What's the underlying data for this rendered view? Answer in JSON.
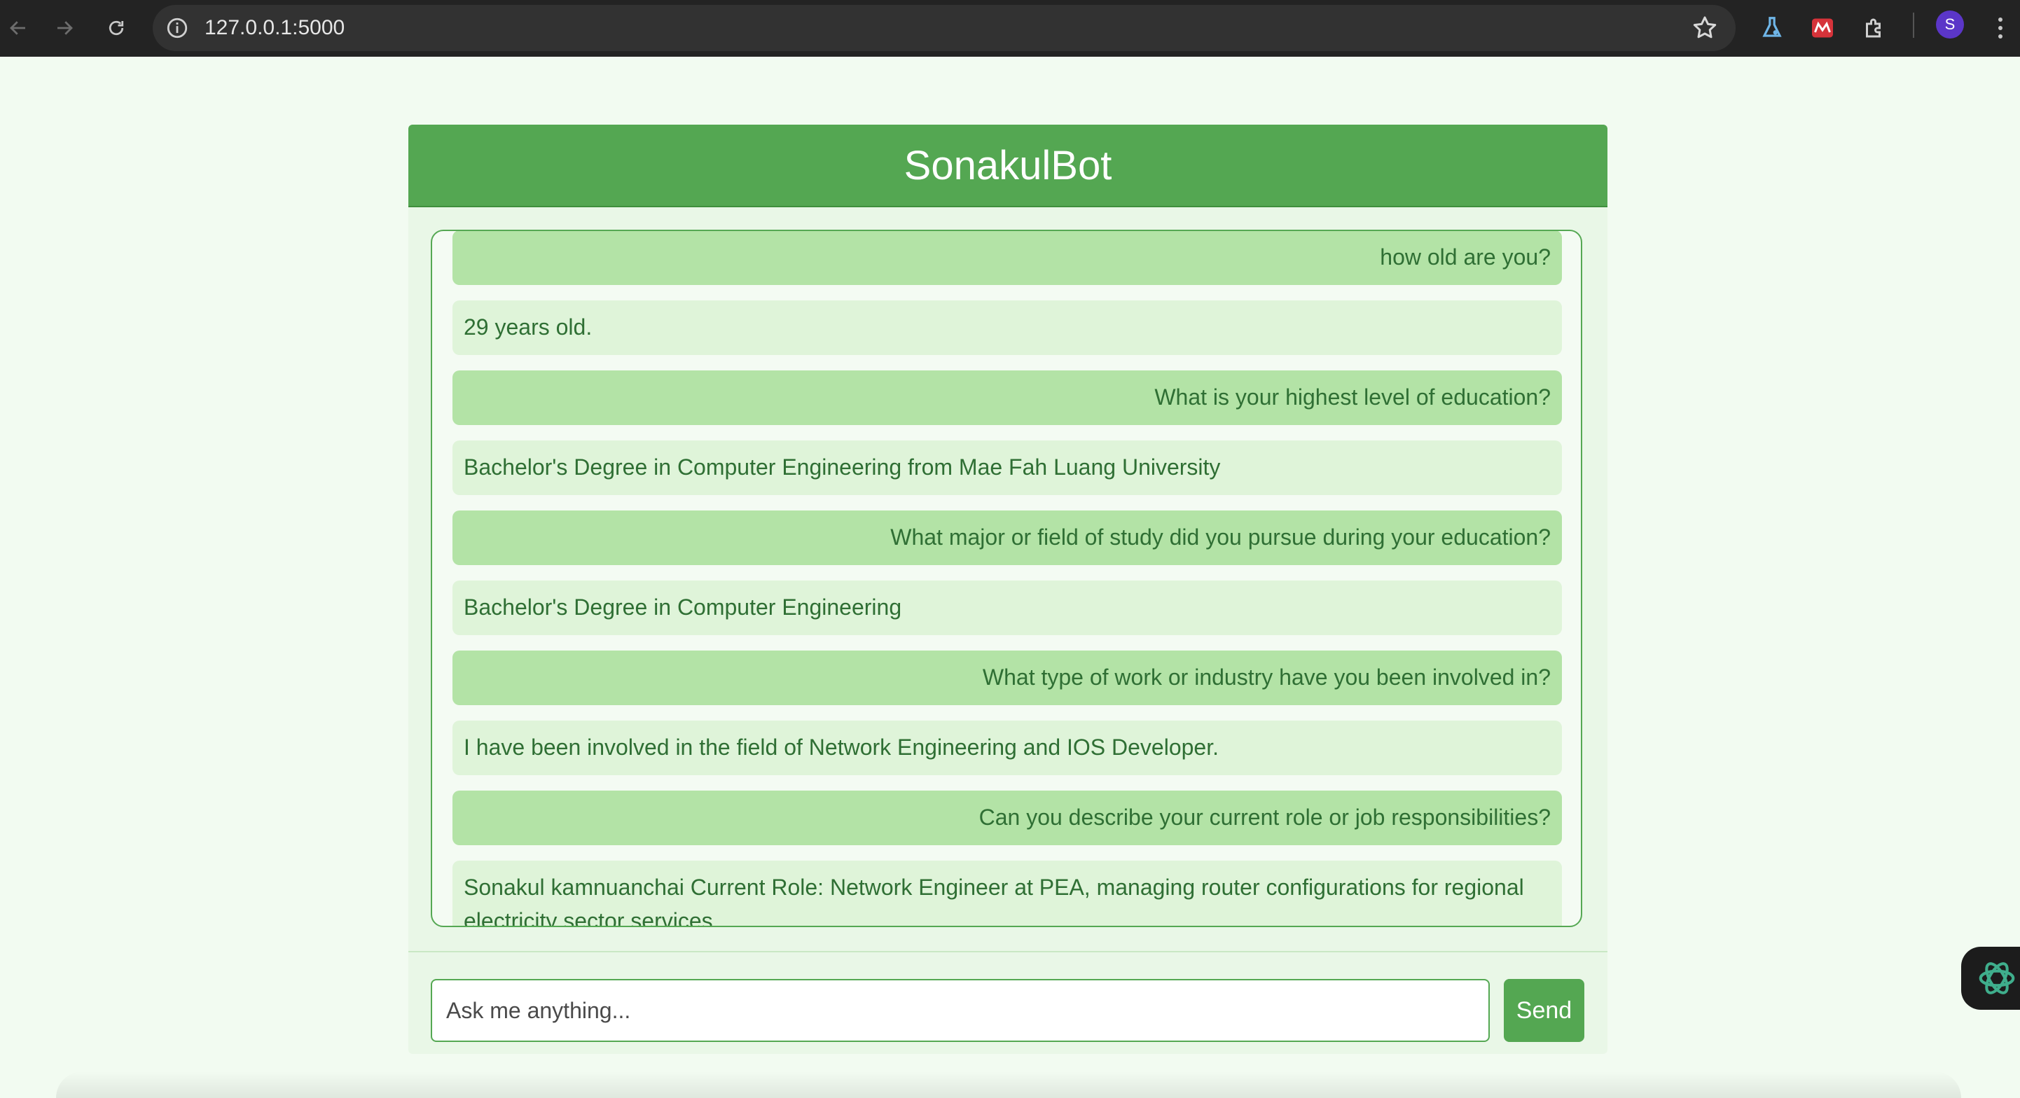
{
  "browser": {
    "url": "127.0.0.1:5000",
    "profile_initial": "S",
    "icons": {
      "back": "arrow-left-icon",
      "forward": "arrow-right-icon",
      "reload": "reload-icon",
      "site_info": "info-icon",
      "bookmark": "star-icon",
      "extension_1": "flask-icon",
      "extension_2": "red-app-icon",
      "extensions": "puzzle-icon",
      "menu": "kebab-menu-icon"
    }
  },
  "chat": {
    "title": "SonakulBot",
    "messages": [
      {
        "role": "user",
        "text": "how old are you?"
      },
      {
        "role": "bot",
        "text": "29 years old."
      },
      {
        "role": "user",
        "text": "What is your highest level of education?"
      },
      {
        "role": "bot",
        "text": "Bachelor's Degree in Computer Engineering from Mae Fah Luang University"
      },
      {
        "role": "user",
        "text": "What major or field of study did you pursue during your education?"
      },
      {
        "role": "bot",
        "text": "Bachelor's Degree in Computer Engineering"
      },
      {
        "role": "user",
        "text": "What type of work or industry have you been involved in?"
      },
      {
        "role": "bot",
        "text": "I have been involved in the field of Network Engineering and IOS Developer."
      },
      {
        "role": "user",
        "text": "Can you describe your current role or job responsibilities?"
      },
      {
        "role": "bot",
        "text": "Sonakul kamnuanchai Current Role: Network Engineer at PEA, managing router configurations for regional electricity sector services."
      }
    ],
    "input_placeholder": "Ask me anything...",
    "send_label": "Send"
  },
  "colors": {
    "header_green": "#54a752",
    "user_bubble": "#b3e3a6",
    "bot_bubble": "#dff4d9",
    "text_green": "#2f6f34"
  }
}
